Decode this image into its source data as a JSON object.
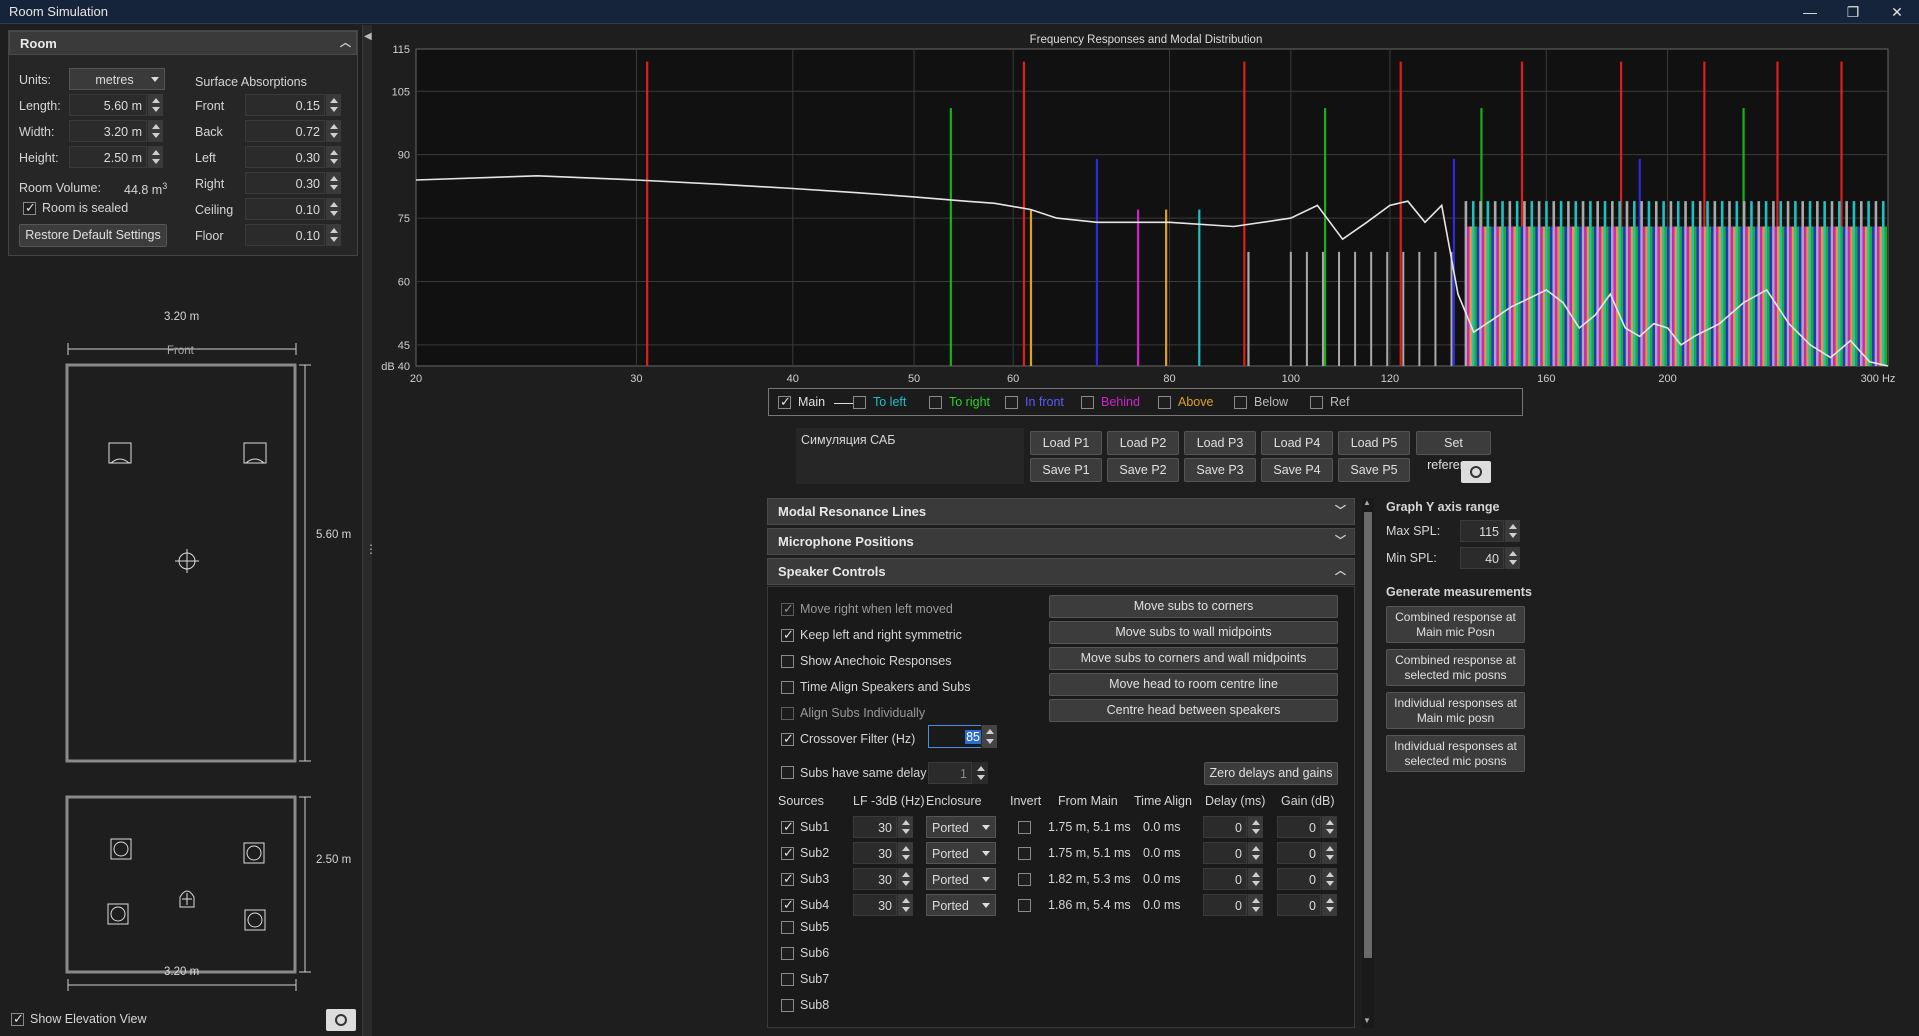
{
  "window": {
    "title": "Room Simulation",
    "min": "—",
    "restore": "❐",
    "close": "✕"
  },
  "room": {
    "header": "Room",
    "units_label": "Units:",
    "units_value": "metres",
    "length_label": "Length:",
    "length_value": "5.60 m",
    "width_label": "Width:",
    "width_value": "3.20 m",
    "height_label": "Height:",
    "height_value": "2.50 m",
    "volume_label": "Room Volume:",
    "volume_value": "44.8 m",
    "volume_sup": "3",
    "sealed_label": "Room is sealed",
    "restore_label": "Restore Default Settings",
    "absorptions_title": "Surface Absorptions",
    "absorptions": [
      {
        "label": "Front",
        "value": "0.15"
      },
      {
        "label": "Back",
        "value": "0.72"
      },
      {
        "label": "Left",
        "value": "0.30"
      },
      {
        "label": "Right",
        "value": "0.30"
      },
      {
        "label": "Ceiling",
        "value": "0.10"
      },
      {
        "label": "Floor",
        "value": "0.10"
      }
    ]
  },
  "plan": {
    "top_dim": "3.20 m",
    "front_label": "Front",
    "side_dim": "5.60 m",
    "elev_side_dim": "2.50 m",
    "elev_bottom_dim": "3.20 m",
    "show_elevation_label": "Show Elevation View"
  },
  "chart_data": {
    "type": "line",
    "title": "Frequency Responses and Modal Distribution",
    "x_scale": "log",
    "xlim": [
      20,
      300
    ],
    "ylim": [
      40,
      115
    ],
    "x_ticks": [
      "20",
      "30",
      "40",
      "50",
      "60",
      "80",
      "100",
      "120",
      "160",
      "200",
      "300 Hz"
    ],
    "y_ticks": [
      "115",
      "105",
      "90",
      "75",
      "60",
      "45",
      "dB 40"
    ],
    "grid": true,
    "main_curve": {
      "name": "Main",
      "x": [
        20,
        25,
        30,
        35,
        40,
        45,
        50,
        55,
        58,
        62,
        65,
        70,
        80,
        90,
        100,
        105,
        110,
        115,
        120,
        124,
        128,
        132,
        136,
        140,
        145,
        150,
        155,
        160,
        165,
        170,
        175,
        180,
        185,
        190,
        195,
        200,
        205,
        210,
        220,
        230,
        240,
        250,
        260,
        270,
        280,
        290,
        300
      ],
      "y": [
        84,
        85,
        84,
        83,
        82,
        81,
        80,
        79,
        78.5,
        77,
        75,
        74,
        74,
        73,
        75,
        78,
        70,
        74,
        78,
        79,
        74,
        78,
        57,
        48,
        51,
        54,
        56,
        58,
        55,
        49,
        52,
        57,
        49,
        47,
        50,
        49,
        45,
        47,
        50,
        55,
        58,
        50,
        45,
        42,
        46,
        41,
        40
      ]
    },
    "modal_lines": [
      {
        "x": 30.6,
        "y": 112,
        "color": "#e01e1e"
      },
      {
        "x": 53.5,
        "y": 101,
        "color": "#19b019"
      },
      {
        "x": 61.2,
        "y": 112,
        "color": "#e01e1e"
      },
      {
        "x": 62.0,
        "y": 77,
        "color": "#e0a020"
      },
      {
        "x": 70.0,
        "y": 89,
        "color": "#2a2ae0"
      },
      {
        "x": 75.5,
        "y": 77,
        "color": "#d020d0"
      },
      {
        "x": 79.5,
        "y": 77,
        "color": "#e0a020"
      },
      {
        "x": 84.5,
        "y": 77,
        "color": "#20c0c0"
      },
      {
        "x": 91.8,
        "y": 112,
        "color": "#e01e1e"
      },
      {
        "x": 92.5,
        "y": 67,
        "color": "#aaaaaa"
      },
      {
        "x": 106.5,
        "y": 101,
        "color": "#19b019"
      },
      {
        "x": 122.4,
        "y": 112,
        "color": "#e01e1e"
      },
      {
        "x": 135.0,
        "y": 89,
        "color": "#2a2ae0"
      },
      {
        "x": 142.0,
        "y": 101,
        "color": "#19b019"
      },
      {
        "x": 153.0,
        "y": 112,
        "color": "#e01e1e"
      },
      {
        "x": 183.6,
        "y": 112,
        "color": "#e01e1e"
      },
      {
        "x": 190.0,
        "y": 89,
        "color": "#2a2ae0"
      },
      {
        "x": 214.0,
        "y": 112,
        "color": "#e01e1e"
      },
      {
        "x": 230.0,
        "y": 101,
        "color": "#19b019"
      },
      {
        "x": 244.8,
        "y": 112,
        "color": "#e01e1e"
      },
      {
        "x": 275.4,
        "y": 112,
        "color": "#e01e1e"
      }
    ],
    "dense_region": {
      "from": 100,
      "to": 300,
      "top": 79,
      "colors": [
        "#aaaaaa",
        "#d020d0",
        "#e0a020",
        "#20c0c0",
        "#19b019",
        "#2a2ae0"
      ]
    }
  },
  "legend": [
    {
      "label": "Main",
      "checked": true,
      "color": "#e0e0e0"
    },
    {
      "label": "To left",
      "checked": false,
      "color": "#20c0c0"
    },
    {
      "label": "To right",
      "checked": false,
      "color": "#2bd02b"
    },
    {
      "label": "In front",
      "checked": false,
      "color": "#5a5aff"
    },
    {
      "label": "Behind",
      "checked": false,
      "color": "#d020d0"
    },
    {
      "label": "Above",
      "checked": false,
      "color": "#e0a020"
    },
    {
      "label": "Below",
      "checked": false,
      "color": "#bbbbbb"
    },
    {
      "label": "Ref",
      "checked": false,
      "color": "#bbbbbb"
    }
  ],
  "presets": {
    "name": "Симуляция САБ",
    "load": [
      "Load P1",
      "Load P2",
      "Load P3",
      "Load P4",
      "Load P5"
    ],
    "save": [
      "Save P1",
      "Save P2",
      "Save P3",
      "Save P4",
      "Save P5"
    ],
    "set_reference": "Set reference"
  },
  "sections": {
    "modal": "Modal Resonance Lines",
    "mics": "Microphone Positions",
    "speakers": "Speaker Controls"
  },
  "speaker": {
    "options": [
      {
        "label": "Move right when left moved",
        "checked": true,
        "dim": true
      },
      {
        "label": "Keep left and right symmetric",
        "checked": true,
        "dim": false
      },
      {
        "label": "Show Anechoic Responses",
        "checked": false,
        "dim": false
      },
      {
        "label": "Time Align Speakers and Subs",
        "checked": false,
        "dim": false
      },
      {
        "label": "Align Subs Individually",
        "checked": false,
        "dim": true
      },
      {
        "label": "Crossover Filter (Hz)",
        "checked": true,
        "dim": false
      }
    ],
    "actions": [
      "Move subs to corners",
      "Move subs to wall midpoints",
      "Move subs to corners and wall midpoints",
      "Move head to room centre line",
      "Centre head between speakers"
    ],
    "crossover_value": "85",
    "same_delay_label": "Subs have same delay",
    "same_delay_value": "1",
    "zero_label": "Zero delays and gains",
    "columns": [
      "Sources",
      "LF -3dB (Hz)",
      "Enclosure",
      "Invert",
      "From Main",
      "Time Align",
      "Delay (ms)",
      "Gain (dB)"
    ],
    "subs": [
      {
        "name": "Sub1",
        "on": true,
        "lf": "30",
        "enclosure": "Ported",
        "from_main": "1.75 m, 5.1 ms",
        "align": "0.0 ms",
        "delay": "0",
        "gain": "0"
      },
      {
        "name": "Sub2",
        "on": true,
        "lf": "30",
        "enclosure": "Ported",
        "from_main": "1.75 m, 5.1 ms",
        "align": "0.0 ms",
        "delay": "0",
        "gain": "0"
      },
      {
        "name": "Sub3",
        "on": true,
        "lf": "30",
        "enclosure": "Ported",
        "from_main": "1.82 m, 5.3 ms",
        "align": "0.0 ms",
        "delay": "0",
        "gain": "0"
      },
      {
        "name": "Sub4",
        "on": true,
        "lf": "30",
        "enclosure": "Ported",
        "from_main": "1.86 m, 5.4 ms",
        "align": "0.0 ms",
        "delay": "0",
        "gain": "0"
      }
    ],
    "extra_subs": [
      "Sub5",
      "Sub6",
      "Sub7",
      "Sub8"
    ]
  },
  "yaxis": {
    "title": "Graph Y axis range",
    "max_label": "Max SPL:",
    "max_value": "115",
    "min_label": "Min SPL:",
    "min_value": "40"
  },
  "measurements": {
    "title": "Generate measurements",
    "buttons": [
      [
        "Combined response at",
        "Main mic Posn"
      ],
      [
        "Combined response at",
        "selected mic posns"
      ],
      [
        "Individual responses at",
        "Main mic posn"
      ],
      [
        "Individual responses at",
        "selected mic posns"
      ]
    ]
  }
}
